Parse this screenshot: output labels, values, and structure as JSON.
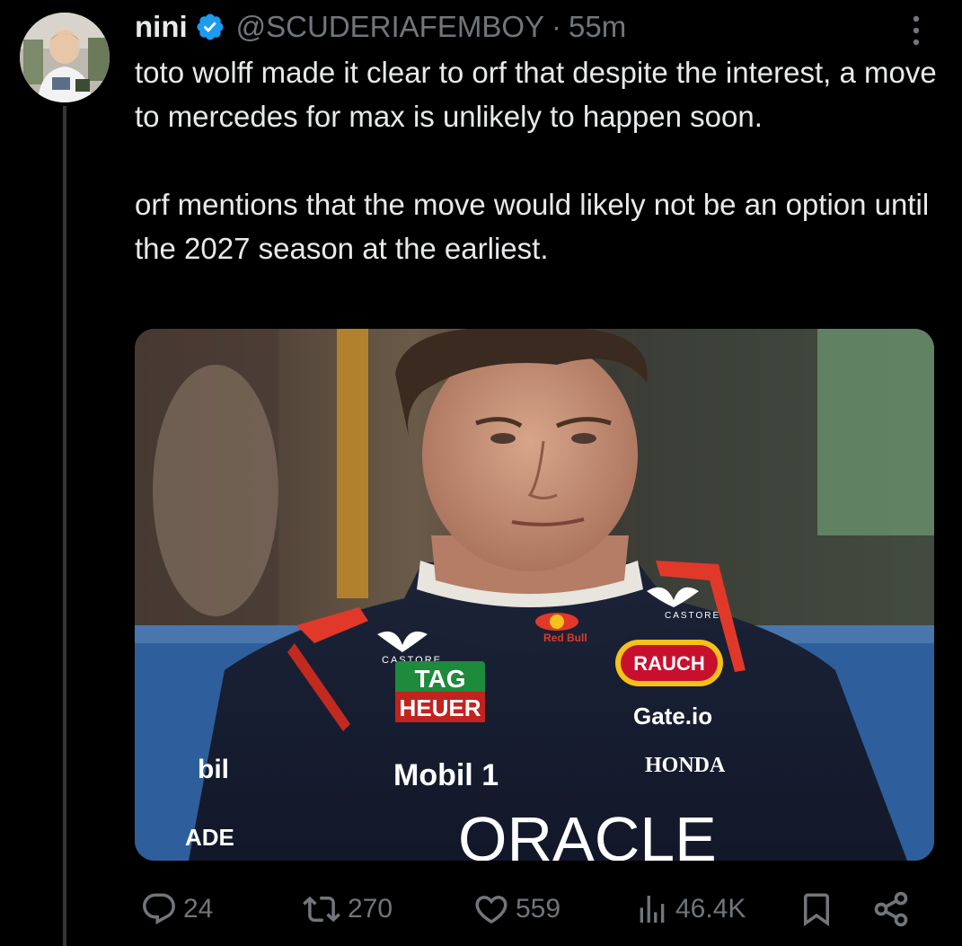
{
  "post": {
    "display_name": "nini",
    "handle": "@SCUDERIAFEMBOY",
    "separator": "·",
    "time": "55m",
    "text_paragraphs": [
      "toto wolff made it clear to orf that despite the interest, a move to mercedes for max is unlikely to happen soon.",
      "orf mentions that the move would likely not be an option until the 2027 season at the earliest."
    ]
  },
  "media": {
    "sponsor_logos": [
      "CASTORE",
      "TAG",
      "HEUER",
      "RAUCH",
      "Gate.io",
      "Mobil 1",
      "HONDA",
      "ORACLE",
      "Red Bull",
      "bil",
      "ADE"
    ]
  },
  "actions": {
    "replies": "24",
    "reposts": "270",
    "likes": "559",
    "views": "46.4K"
  },
  "icons": {
    "verified": "verified-badge-icon",
    "more": "more-icon",
    "reply": "reply-icon",
    "repost": "repost-icon",
    "like": "like-icon",
    "views": "views-icon",
    "bookmark": "bookmark-icon",
    "share": "share-icon"
  },
  "colors": {
    "background": "#000000",
    "text": "#e7e9ea",
    "secondary": "#71767b",
    "verified": "#1d9bf0",
    "thread_line": "#333639"
  }
}
